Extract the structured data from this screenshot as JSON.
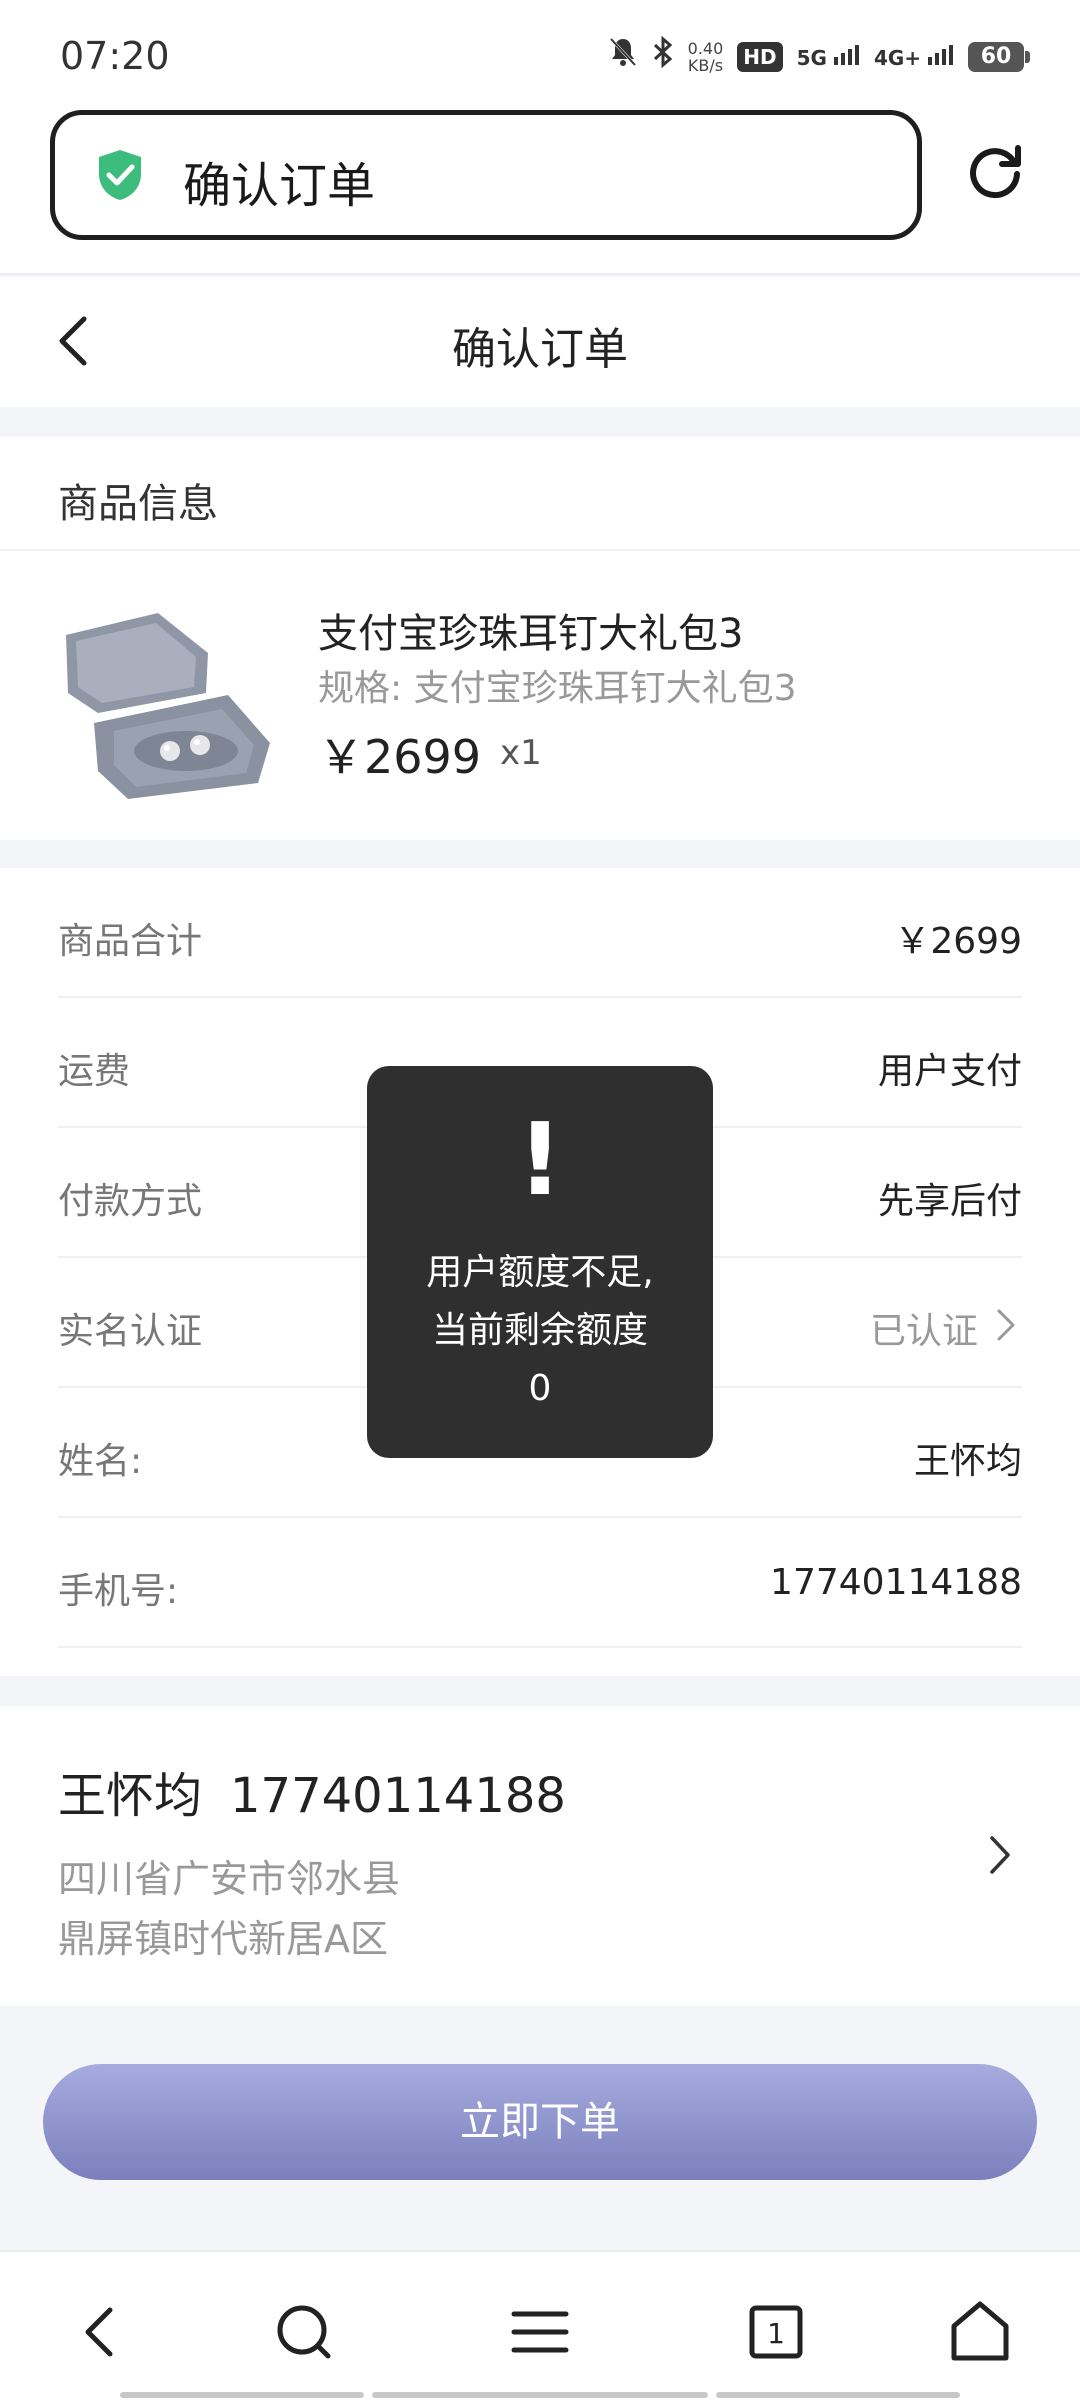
{
  "status_bar": {
    "time": "07:20",
    "speed_value": "0.40",
    "speed_unit": "KB/s",
    "hd_label": "HD",
    "net1": "5G",
    "net2": "4G+",
    "battery": "60"
  },
  "browser": {
    "address_text": "确认订单",
    "icons": [
      "shield-check-icon",
      "reload-icon"
    ]
  },
  "header": {
    "title": "确认订单"
  },
  "product_section": {
    "title": "商品信息",
    "product": {
      "name": "支付宝珍珠耳钉大礼包3",
      "spec_label": "规格:",
      "spec_value": "支付宝珍珠耳钉大礼包3",
      "price": "￥2699",
      "quantity": "x1"
    }
  },
  "details": {
    "rows": [
      {
        "label": "商品合计",
        "value": "￥2699"
      },
      {
        "label": "运费",
        "value": "用户支付"
      },
      {
        "label": "付款方式",
        "value": "先享后付"
      },
      {
        "label": "实名认证",
        "value": "已认证"
      },
      {
        "label": "姓名:",
        "value": "王怀均"
      },
      {
        "label": "手机号:",
        "value": "17740114188"
      }
    ]
  },
  "address": {
    "name": "王怀均",
    "phone": "17740114188",
    "line1": "四川省广安市邻水县",
    "line2": "鼎屏镇时代新居A区"
  },
  "order_button": {
    "label": "立即下单"
  },
  "toast": {
    "icon": "!",
    "line1": "用户额度不足,",
    "line2": "当前剩余额度",
    "line3": "0"
  },
  "bottom_nav": {
    "tab_count": "1",
    "icons": [
      "back-icon",
      "search-icon",
      "menu-icon",
      "tabs-icon",
      "home-icon"
    ]
  },
  "colors": {
    "accent_button_top": "#a6acdf",
    "accent_button_bottom": "#7b80bd",
    "shield_green": "#3dbd7d",
    "toast_bg": "#2f2f2f"
  }
}
